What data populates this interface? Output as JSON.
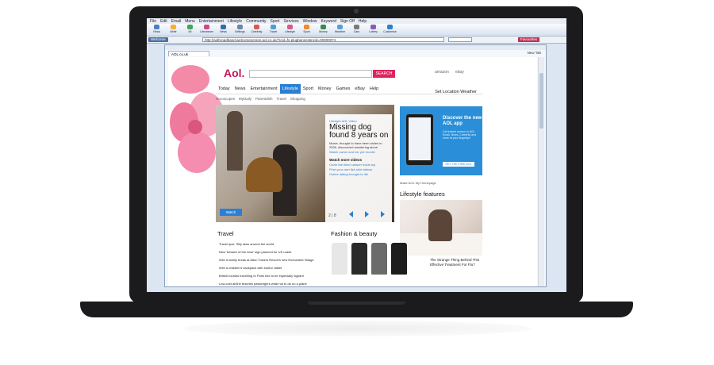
{
  "menu": [
    "File",
    "Edit",
    "Email",
    "Menu",
    "Entertainment",
    "Lifestyle",
    "Community",
    "Sport",
    "Services",
    "Window",
    "Keyword",
    "Sign Off",
    "Help"
  ],
  "toolbar": [
    "Read",
    "Write",
    "IM",
    "Lifestream",
    "News",
    "Settings",
    "Celebrity",
    "Travel",
    "Lifestyle",
    "Sport",
    "Money",
    "Weather",
    "Cars",
    "Lottery",
    "Customise"
  ],
  "address": {
    "welcome": "Welcome",
    "url": "http://aolbroadband.welcomescreen.aol.co.uk/?icid=fs-plugbanner&ncid=00000074",
    "favourites": "Favourites"
  },
  "tab": {
    "label": "AOL.co.uk",
    "new_tab": "New Tab"
  },
  "header": {
    "logo": "Aol.",
    "search_button": "SEARCH",
    "brands": [
      "amazon",
      "ebay"
    ]
  },
  "nav": {
    "items": [
      "Today",
      "News",
      "Entertainment",
      "Lifestyle",
      "Sport",
      "Money",
      "Games",
      "eBay",
      "Help"
    ],
    "active": "Lifestyle",
    "right": "Set Location   Weather"
  },
  "subnav": [
    "Horoscopes",
    "MyDaily",
    "Parentdish",
    "Travel",
    "Shopping"
  ],
  "feature": {
    "category": "Lifestyle AOL Video",
    "title": "Missing dog found 8 years on",
    "desc": "Moxie, thought to have been stolen in 2006, discovered wandering alone",
    "link": "Watch owner and her pet reunite",
    "more_title": "Watch more videos",
    "more_links": [
      "Ozzie the blind camper holds top",
      "Print your own fish skin tattoos",
      "Online dating brought to life"
    ],
    "watch_label": "Watch",
    "pager": "2 | 8"
  },
  "ad": {
    "title": "Discover the new AOL app",
    "sub": "Get instant access to AOL Email, News, Celebrity and more at your fingertips",
    "button": "GET THE FREE AOL APP"
  },
  "make_home": "Make AOL My Homepage",
  "lifestyle": {
    "heading": "Lifestyle features",
    "caption": "The Strange Thing Behind This Effective Treatment For Flu?"
  },
  "travel": {
    "heading": "Travel",
    "items": [
      "Travel quiz: Silly laws around the world",
      "New 'beware of the bear' sign planned for UK roads",
      "Win! A family break at Alton Towers Resort's new Enchanted Village",
      "Win! A children's backpack with built-in tablet",
      "British tourists travelling to Paris told to be especially vigilant",
      "Low-cost airline teaches passengers what not to do on a plane"
    ]
  },
  "fashion": {
    "heading": "Fashion & beauty",
    "outfit_colors": [
      "#e7e7e7",
      "#2a2a2a",
      "#6b6b6b",
      "#1d1d1d"
    ]
  },
  "colors": {
    "accent": "#2a7fd4",
    "brand": "#c2185b",
    "search": "#e0245e",
    "ad": "#2a8fd8"
  }
}
